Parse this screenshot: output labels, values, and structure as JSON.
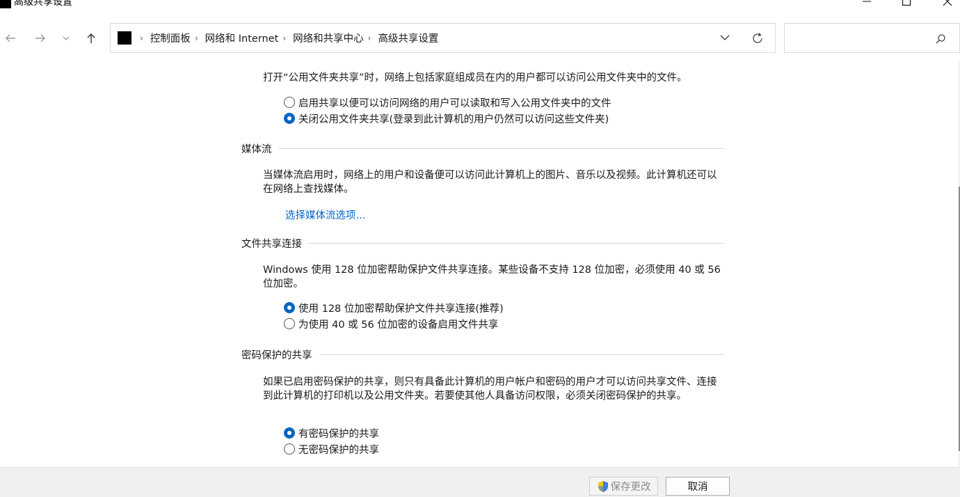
{
  "window": {
    "title": "高级共享设置"
  },
  "breadcrumbs": [
    "控制面板",
    "网络和 Internet",
    "网络和共享中心",
    "高级共享设置"
  ],
  "search": {
    "placeholder": ""
  },
  "public_folder": {
    "description": "打开“公用文件夹共享”时，网络上包括家庭组成员在内的用户都可以访问公用文件夹中的文件。",
    "options": [
      {
        "label": "启用共享以便可以访问网络的用户可以读取和写入公用文件夹中的文件",
        "checked": false
      },
      {
        "label": "关闭公用文件夹共享(登录到此计算机的用户仍然可以访问这些文件夹)",
        "checked": true
      }
    ]
  },
  "media_streaming": {
    "heading": "媒体流",
    "description": "当媒体流启用时，网络上的用户和设备便可以访问此计算机上的图片、音乐以及视频。此计算机还可以在网络上查找媒体。",
    "link": "选择媒体流选项..."
  },
  "file_sharing": {
    "heading": "文件共享连接",
    "description": "Windows 使用 128 位加密帮助保护文件共享连接。某些设备不支持 128 位加密，必须使用 40 或 56 位加密。",
    "options": [
      {
        "label": "使用 128 位加密帮助保护文件共享连接(推荐)",
        "checked": true
      },
      {
        "label": "为使用 40 或 56 位加密的设备启用文件共享",
        "checked": false
      }
    ]
  },
  "password_sharing": {
    "heading": "密码保护的共享",
    "description": "如果已启用密码保护的共享，则只有具备此计算机的用户帐户和密码的用户才可以访问共享文件、连接到此计算机的打印机以及公用文件夹。若要使其他人具备访问权限，必须关闭密码保护的共享。",
    "options": [
      {
        "label": "有密码保护的共享",
        "checked": true
      },
      {
        "label": "无密码保护的共享",
        "checked": false
      }
    ]
  },
  "footer": {
    "save_label": "保存更改",
    "cancel_label": "取消"
  }
}
